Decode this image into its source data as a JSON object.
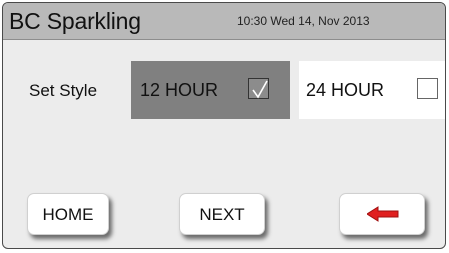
{
  "header": {
    "title": "BC Sparkling",
    "datetime": "10:30 Wed 14, Nov 2013"
  },
  "settings": {
    "label": "Set Style",
    "options": [
      {
        "label": "12 HOUR",
        "checked": true
      },
      {
        "label": "24 HOUR",
        "checked": false
      }
    ]
  },
  "footer": {
    "home_label": "HOME",
    "next_label": "NEXT",
    "back_icon": "left-arrow-icon"
  },
  "colors": {
    "title_bar": "#b9b9b9",
    "background": "#ececec",
    "selected_option": "#808080",
    "unselected_option": "#ffffff",
    "back_arrow": "#e02020"
  }
}
